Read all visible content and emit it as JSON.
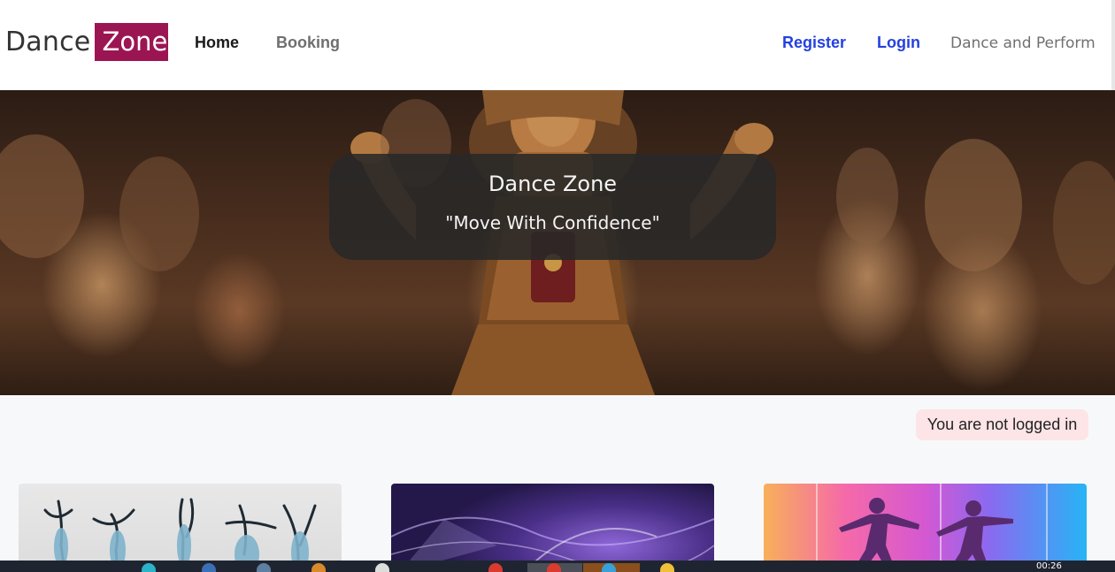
{
  "brand": {
    "part1": "Dance",
    "part2": "Zone"
  },
  "nav": {
    "home": "Home",
    "booking": "Booking",
    "register": "Register",
    "login": "Login",
    "tagline": "Dance and Perform"
  },
  "hero": {
    "title": "Dance Zone",
    "subtitle": "\"Move With Confidence\""
  },
  "status": {
    "text": "You are not logged in"
  },
  "cards": [
    {
      "theme": "dancer-silhouettes"
    },
    {
      "theme": "purple-smoke"
    },
    {
      "theme": "neon-dancers"
    }
  ],
  "taskbar": {
    "clock": "00:26"
  },
  "colors": {
    "brand_accent": "#9c1553",
    "link_blue": "#2540e0",
    "status_bg": "#fde4e6"
  }
}
